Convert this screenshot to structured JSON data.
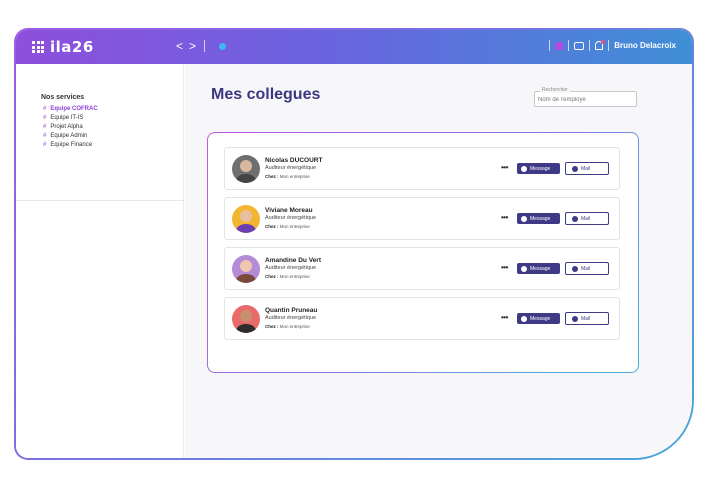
{
  "app": {
    "logo_text": "ila26",
    "user_name": "Bruno Delacroix"
  },
  "sidebar": {
    "title": "Nos services",
    "items": [
      {
        "label": "Equipe COFRAC",
        "active": true
      },
      {
        "label": "Equipe IT-IS",
        "active": false
      },
      {
        "label": "Projet Alpha",
        "active": false
      },
      {
        "label": "Equipe Admin",
        "active": false
      },
      {
        "label": "Equipe Finance",
        "active": false
      }
    ]
  },
  "main": {
    "title": "Mes collegues",
    "search": {
      "legend": "Rechercher",
      "placeholder": "Nom de l'employé"
    }
  },
  "colleagues": [
    {
      "name": "Nicolas DUCOURT",
      "role": "Auditeur énergétique",
      "company_prefix": "Chez :",
      "company": "Mon entreprise",
      "avatar_bg": "#6f6f6f"
    },
    {
      "name": "Viviane Moreau",
      "role": "Auditeur énergétique",
      "company_prefix": "Chez :",
      "company": "Mon entreprise",
      "avatar_bg": "#f2b630"
    },
    {
      "name": "Amandine Du Vert",
      "role": "Auditeur énergétique",
      "company_prefix": "Chez :",
      "company": "Mon entreprise",
      "avatar_bg": "#b58ad6"
    },
    {
      "name": "Quantin Pruneau",
      "role": "Auditeur énergétique",
      "company_prefix": "Chez :",
      "company": "Mon entreprise",
      "avatar_bg": "#e96a6a"
    }
  ],
  "actions": {
    "more": "•••",
    "message_label": "Message",
    "mail_label": "Mail"
  }
}
